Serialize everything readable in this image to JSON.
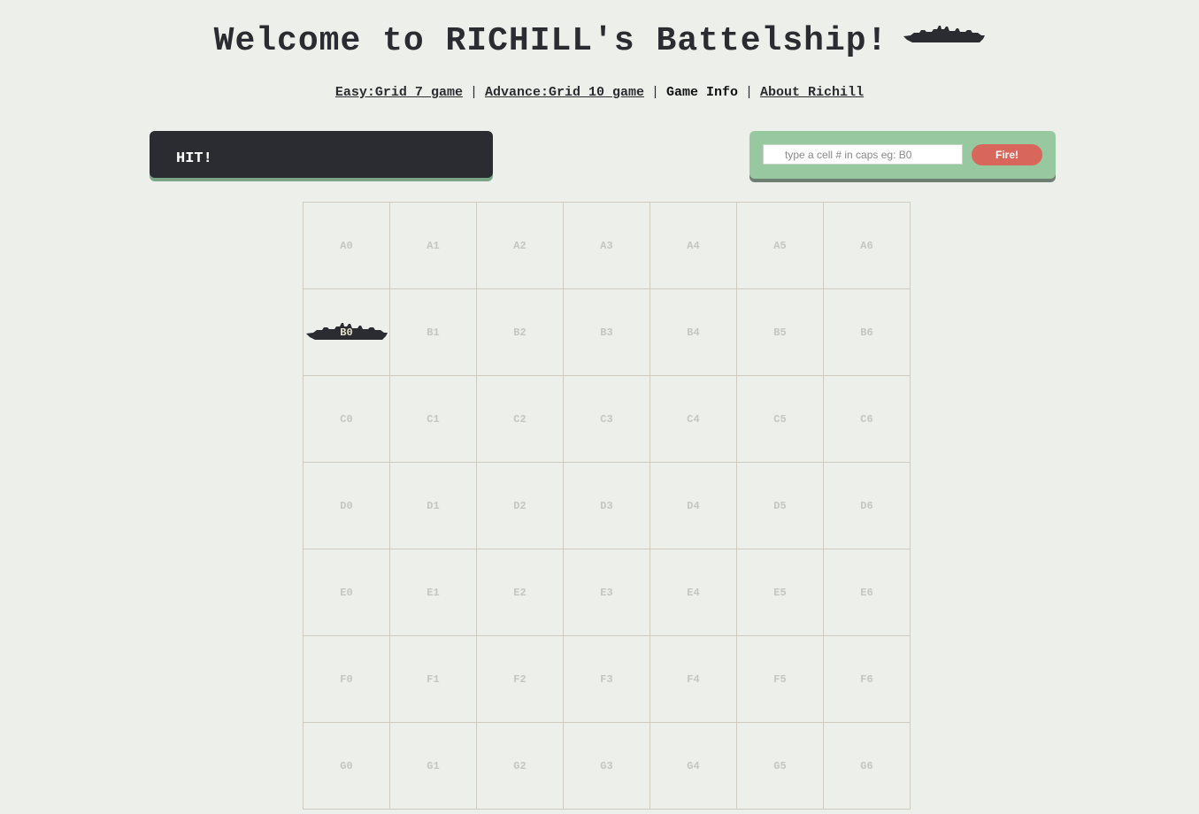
{
  "header": {
    "title": "Welcome to RICHILL's Battelship!",
    "icon": "battleship-icon"
  },
  "nav": {
    "items": [
      {
        "label": "Easy:Grid 7 game",
        "link": true
      },
      {
        "label": "Advance:Grid 10 game",
        "link": true
      },
      {
        "label": "Game Info",
        "link": false
      },
      {
        "label": "About Richill",
        "link": true
      }
    ],
    "separator": "|"
  },
  "message": {
    "text": "HIT!"
  },
  "fire_form": {
    "input_value": "",
    "placeholder": "type a cell # in caps eg: B0",
    "button_label": "Fire!"
  },
  "colors": {
    "background": "#ecefea",
    "message_bg": "#2b2c31",
    "form_bg": "#97c8a0",
    "fire_button": "#d9665a"
  },
  "board": {
    "rows": [
      "A",
      "B",
      "C",
      "D",
      "E",
      "F",
      "G"
    ],
    "cols": [
      "0",
      "1",
      "2",
      "3",
      "4",
      "5",
      "6"
    ],
    "hits": [
      "B0"
    ]
  }
}
